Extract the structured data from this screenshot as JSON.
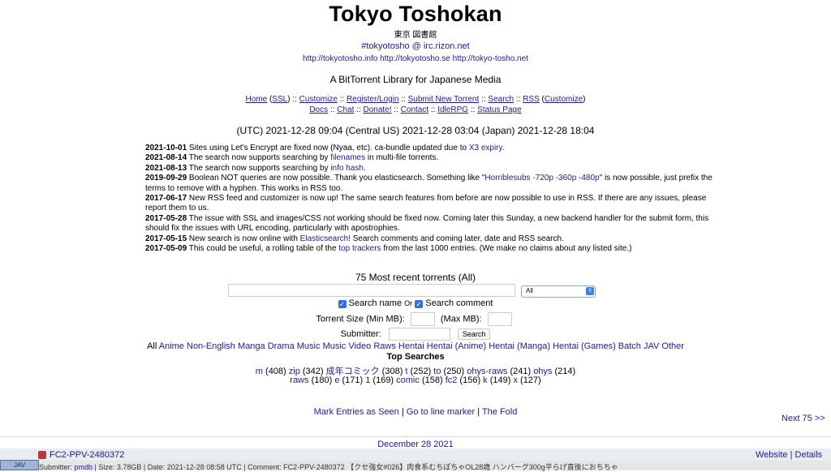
{
  "header": {
    "title": "Tokyo Toshokan",
    "subtitle": "東京 図書館",
    "irc": "#tokyotosho @ irc.rizon.net",
    "mirrors": "http://tokyotosho.info http://tokyotosho.se http://tokyo-tosho.net",
    "tagline": "A BitTorrent Library for Japanese Media"
  },
  "nav": {
    "home": "Home",
    "ssl": "SSL",
    "customize": "Customize",
    "register": "Register/Login",
    "submit": "Submit New Torrent",
    "search": "Search",
    "rss": "RSS",
    "customize2": "Customize",
    "docs": "Docs",
    "chat": "Chat",
    "donate": "Donate!",
    "contact": "Contact",
    "idlerpg": "IdleRPG",
    "status": "Status Page"
  },
  "times": "(UTC) 2021-12-28 09:04 (Central US) 2021-12-28 03:04 (Japan) 2021-12-28 18:04",
  "news": [
    {
      "date": "2021-10-01",
      "pre": " Sites using Let's Encrypt are fixed now (Nyaa, etc). ca-bundle updated due to ",
      "link": "X3 expiry.",
      "post": ""
    },
    {
      "date": "2021-08-14",
      "pre": " The search now supports searching by ",
      "link": "filenames",
      "post": " in multi-file torrents."
    },
    {
      "date": "2021-08-13",
      "pre": " The search now supports searching by ",
      "link": "info hash.",
      "post": ""
    },
    {
      "date": "2019-09-29",
      "pre": " Boolean NOT queries are now possible. Thank you elasticsearch. Something like \"",
      "link": "Horriblesubs -720p -360p -480p",
      "post": "\" is now possible, just prefix the terms to remove with a hyphen. This works in RSS too."
    },
    {
      "date": "2017-06-17",
      "pre": " New RSS feed and customizer is now up! The same search features from before are now possible to use in RSS. If there are any issues, please report them to us.",
      "link": "",
      "post": ""
    },
    {
      "date": "2017-05-28",
      "pre": " The issue with SSL and images/CSS not working should be fixed now. Coming later this Sunday, a new backend handler for the submit form, this should fix the issues with URL encoding, particularly with apostrophies.",
      "link": "",
      "post": ""
    },
    {
      "date": "2017-05-15",
      "pre": " New search is now online with ",
      "link": "Elasticsearch!",
      "post": " Search comments and coming later, date and RSS search."
    },
    {
      "date": "2017-05-09",
      "pre": " This could be useful, a rolling table of the ",
      "link": "top trackers",
      "post": " from the last 1000 entries. (We make no claims about any listed site.)"
    }
  ],
  "search": {
    "recent_heading": "75 Most recent torrents (All)",
    "category_selected": "All",
    "opt_name": "Search name",
    "opt_or": "Or",
    "opt_comment": "Search comment",
    "size_min_label": "Torrent Size (Min MB):",
    "size_max_label": "(Max MB):",
    "submitter_label": "Submitter:",
    "search_button": "Search"
  },
  "categories": [
    "All",
    "Anime",
    "Non-English",
    "Manga",
    "Drama",
    "Music",
    "Music Video",
    "Raws",
    "Hentai",
    "Hentai (Anime)",
    "Hentai (Manga)",
    "Hentai (Games)",
    "Batch",
    "JAV",
    "Other"
  ],
  "top_searches": {
    "heading": "Top Searches",
    "line1": [
      {
        "term": "m",
        "count": "(408)"
      },
      {
        "term": "zip",
        "count": "(342)"
      },
      {
        "term": "成年コミック",
        "count": "(308)"
      },
      {
        "term": "t",
        "count": "(252)"
      },
      {
        "term": "to",
        "count": "(250)"
      },
      {
        "term": "ohys-raws",
        "count": "(241)"
      },
      {
        "term": "ohys",
        "count": "(214)"
      }
    ],
    "line2": [
      {
        "term": "raws",
        "count": "(180)"
      },
      {
        "term": "e",
        "count": "(171)"
      },
      {
        "term": "1",
        "count": "(169)"
      },
      {
        "term": "comic",
        "count": "(158)"
      },
      {
        "term": "fc2",
        "count": "(156)"
      },
      {
        "term": "k",
        "count": "(149)"
      },
      {
        "term": "x",
        "count": "(127)"
      }
    ]
  },
  "footer": {
    "mark_seen": "Mark Entries as Seen",
    "line_marker": "Go to line marker",
    "fold": "The Fold",
    "next": "Next 75 >>"
  },
  "listing": {
    "date_heading": "December 28 2021",
    "row_title": "FC2-PPV-2480372",
    "category_badge": "JAV",
    "website": "Website",
    "details": "Details",
    "meta_prefix": "Submitter: ",
    "submitter": "pmdb",
    "meta_rest": " | Size: 3.78GB | Date: 2021-12-28 08:58 UTC | Comment: FC2-PPV-2480372 【クセ強女#026】肉食系むちぽちゃOL28歳 ハンバーグ300g平らげ直後におちちゃ"
  }
}
